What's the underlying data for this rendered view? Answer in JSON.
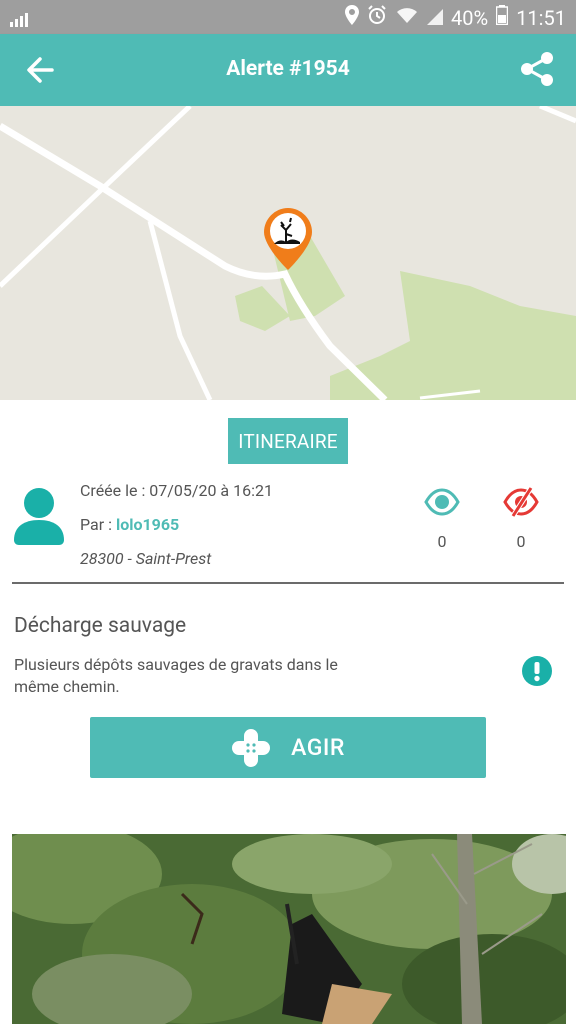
{
  "status_bar": {
    "battery_percent": "40%",
    "time": "11:51"
  },
  "app_bar": {
    "title": "Alerte #1954",
    "back_icon": "arrow-left-icon",
    "share_icon": "share-icon"
  },
  "map": {
    "marker_icon": "dumping-site-marker-icon"
  },
  "itinerary_label": "ITINERAIRE",
  "author": {
    "created_label": "Créée le : 07/05/20 à 16:21",
    "by_prefix": "Par : ",
    "username": "lolo1965",
    "location": "28300 - Saint-Prest"
  },
  "stats": {
    "views_count": "0",
    "hidden_count": "0"
  },
  "alert": {
    "type": "Décharge sauvage",
    "description": "Plusieurs dépôts sauvages de gravats dans le même chemin."
  },
  "action": {
    "label": "AGIR"
  },
  "colors": {
    "accent": "#4fbbb5",
    "marker": "#f07d1a",
    "hidden_icon": "#e53935",
    "status_bar": "#9e9e9e"
  }
}
